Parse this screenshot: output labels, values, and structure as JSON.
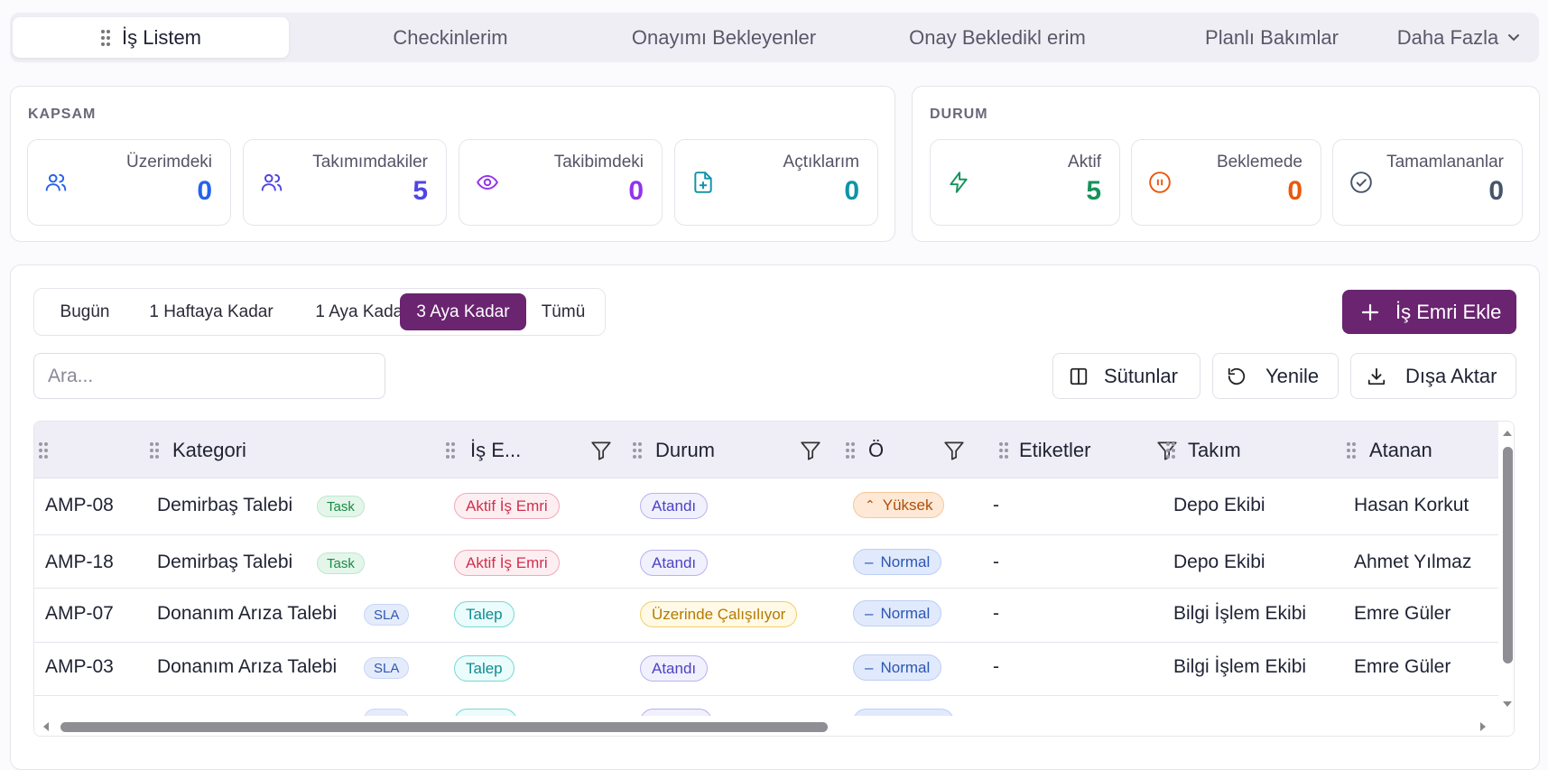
{
  "tabs": [
    {
      "label": "İş Listem",
      "active": true
    },
    {
      "label": "Checkinlerim"
    },
    {
      "label": "Onayımı Bekleyenler"
    },
    {
      "label": "Onay Bekledikl erim"
    },
    {
      "label": "Planlı Bakımlar"
    },
    {
      "label": "Daha Fazla"
    }
  ],
  "kapsam": {
    "title": "KAPSAM",
    "stats": [
      {
        "label": "Üzerimdeki",
        "value": "0",
        "color": "#2563eb",
        "icon": "users-icon"
      },
      {
        "label": "Takımımdakiler",
        "value": "5",
        "color": "#4f46e5",
        "icon": "team-icon"
      },
      {
        "label": "Takibimdeki",
        "value": "0",
        "color": "#9333ea",
        "icon": "eye-icon"
      },
      {
        "label": "Açtıklarım",
        "value": "0",
        "color": "#0e94a8",
        "icon": "file-plus-icon"
      }
    ]
  },
  "durum": {
    "title": "DURUM",
    "stats": [
      {
        "label": "Aktif",
        "value": "5",
        "color": "#15935a",
        "icon": "bolt-icon"
      },
      {
        "label": "Beklemede",
        "value": "0",
        "color": "#ea580c",
        "icon": "pause-icon"
      },
      {
        "label": "Tamamlananlar",
        "value": "0",
        "color": "#475569",
        "icon": "check-circle-icon"
      }
    ]
  },
  "ranges": [
    "Bugün",
    "1 Haftaya Kadar",
    "1 Aya Kadar",
    "3 Aya Kadar",
    "Tümü"
  ],
  "add_button": "İş Emri Ekle",
  "search_placeholder": "Ara...",
  "toolbar": {
    "columns": "Sütunlar",
    "refresh": "Yenile",
    "export": "Dışa Aktar"
  },
  "columns": [
    "Kategori",
    "İş E...",
    "Durum",
    "Ö",
    "Etiketler",
    "Takım",
    "Atanan"
  ],
  "rows": [
    {
      "id": "AMP-08",
      "category": "Demirbaş Talebi",
      "tag": "Task",
      "type": "Aktif İş Emri",
      "status": "Atandı",
      "priority": "Yüksek",
      "labels": "-",
      "team": "Depo Ekibi",
      "assignee": "Hasan Korkut"
    },
    {
      "id": "AMP-18",
      "category": "Demirbaş Talebi",
      "tag": "Task",
      "type": "Aktif İş Emri",
      "status": "Atandı",
      "priority": "Normal",
      "labels": "-",
      "team": "Depo Ekibi",
      "assignee": "Ahmet Yılmaz"
    },
    {
      "id": "AMP-07",
      "category": "Donanım Arıza Talebi",
      "tag": "SLA",
      "type": "Talep",
      "status": "Üzerinde Çalışılıyor",
      "priority": "Normal",
      "labels": "-",
      "team": "Bilgi İşlem Ekibi",
      "assignee": "Emre Güler"
    },
    {
      "id": "AMP-03",
      "category": "Donanım Arıza Talebi",
      "tag": "SLA",
      "type": "Talep",
      "status": "Atandı",
      "priority": "Normal",
      "labels": "-",
      "team": "Bilgi İşlem Ekibi",
      "assignee": "Emre Güler"
    }
  ],
  "colors": {
    "accent": "#6a2470"
  }
}
